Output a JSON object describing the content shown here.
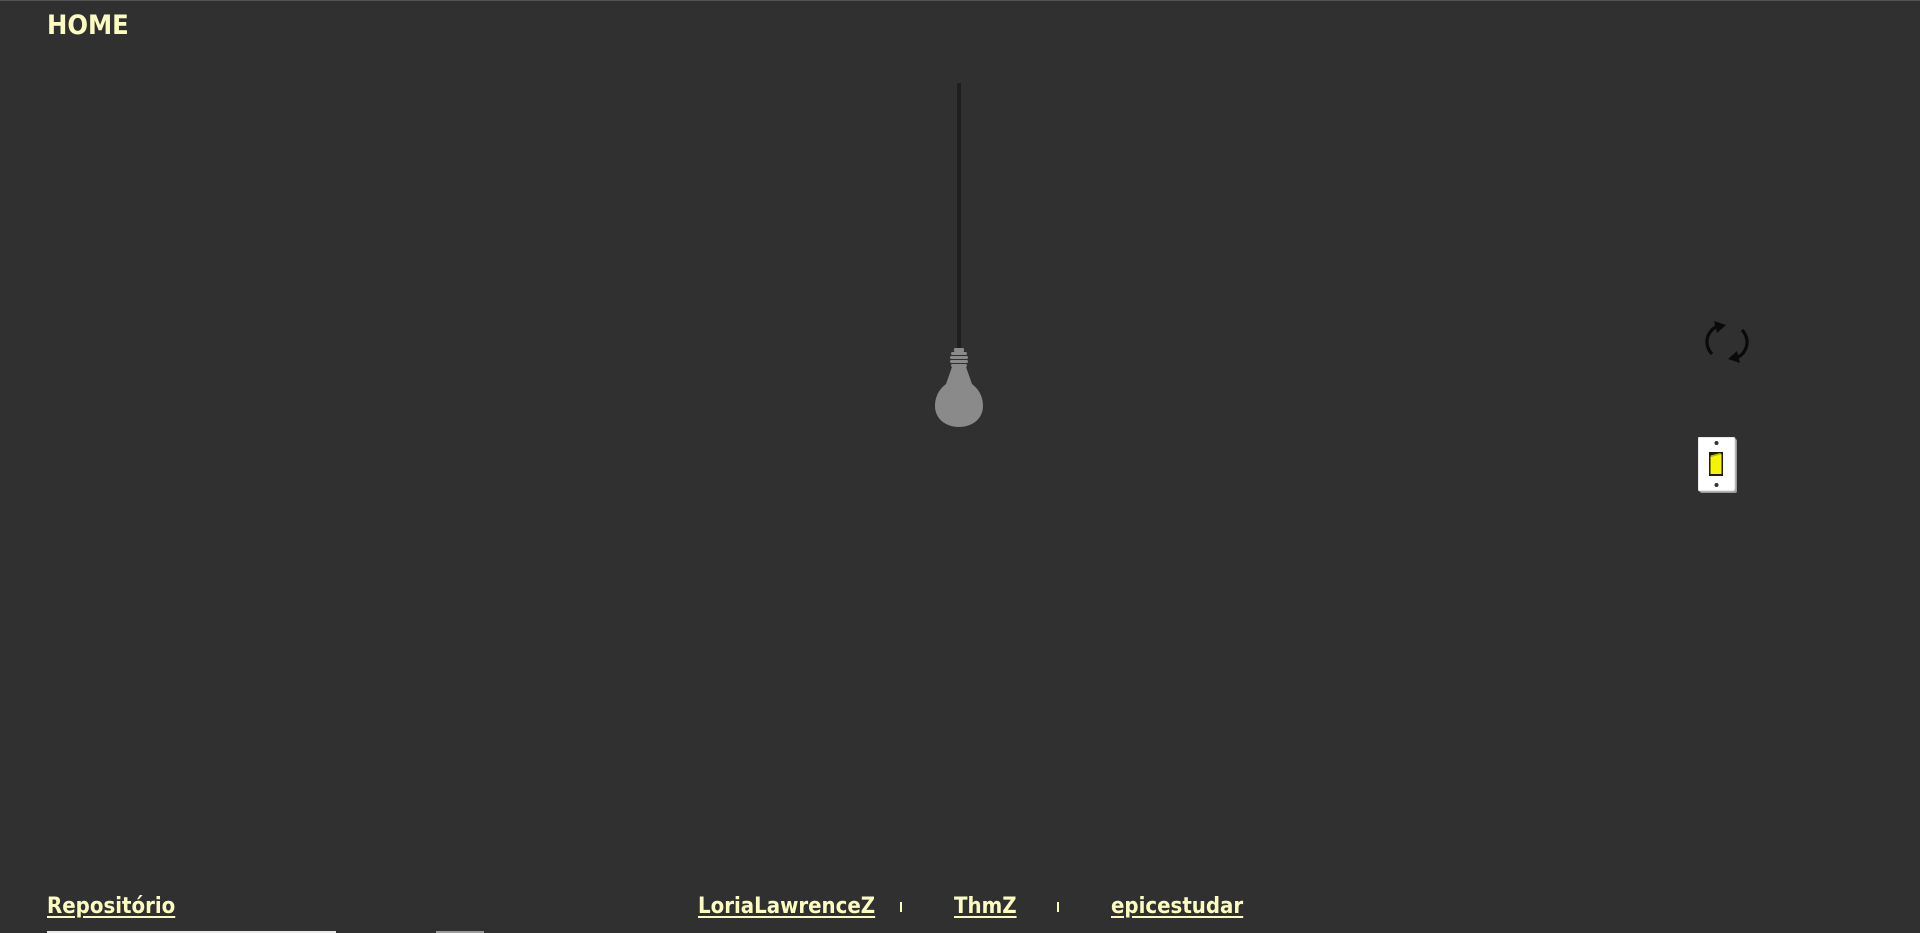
{
  "header": {
    "home_label": "HOME"
  },
  "lamp": {
    "state": "off",
    "bulb_color": "#8a8a8a",
    "cord_color": "#1e1e1e"
  },
  "controls": {
    "refresh_icon": "refresh-icon",
    "switch_icon": "light-switch-icon",
    "switch_toggle_color": "#f5f500"
  },
  "footer": {
    "repo_label": "Repositório",
    "authors": [
      "LoriaLawrenceZ",
      "ThmZ",
      "epicestudar"
    ]
  },
  "colors": {
    "background": "#303030",
    "accent_text": "#fdfcc0"
  }
}
